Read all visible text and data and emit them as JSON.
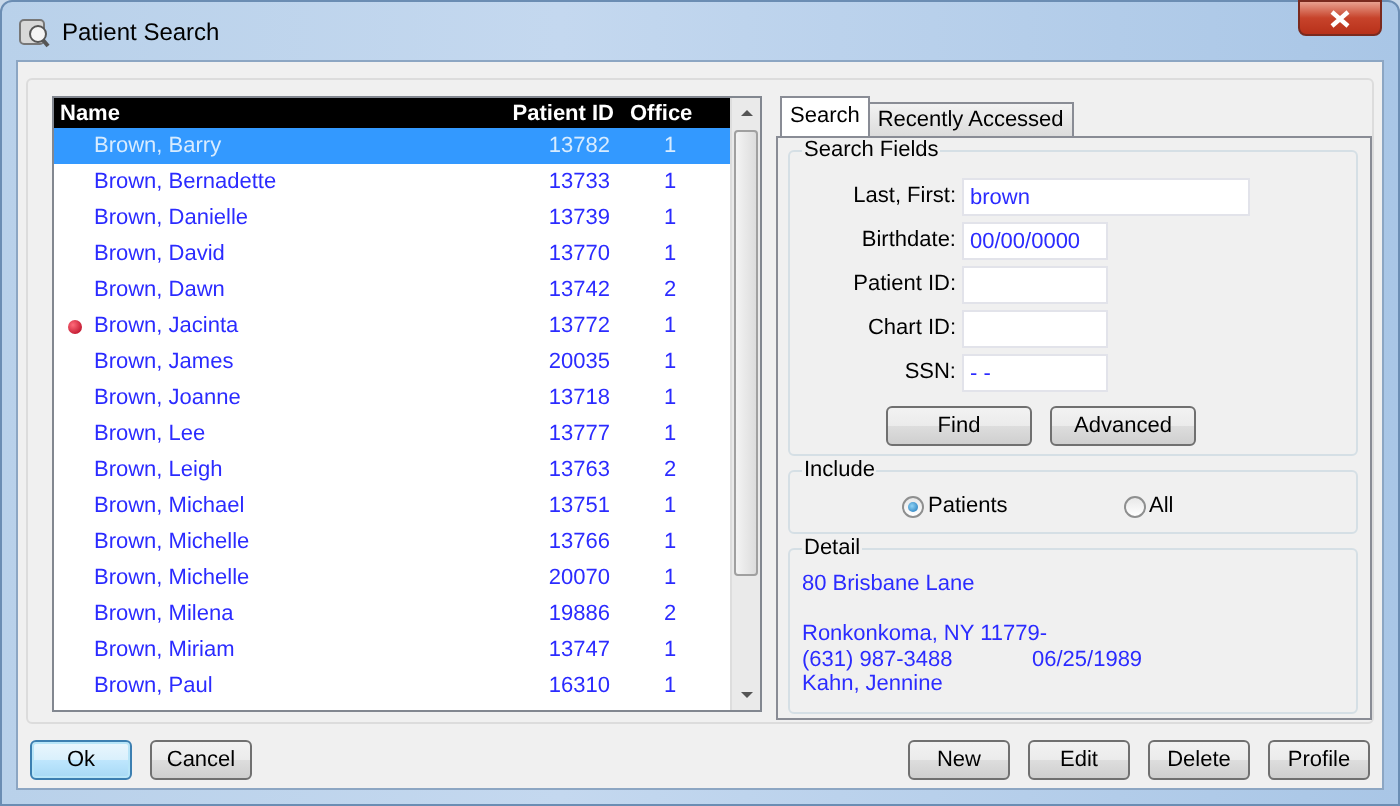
{
  "window": {
    "title": "Patient Search"
  },
  "patient_list": {
    "columns": [
      "Name",
      "Patient ID",
      "Office"
    ],
    "rows": [
      {
        "name": "Brown, Barry",
        "patient_id": "13782",
        "office": "1",
        "selected": true,
        "flagged": false
      },
      {
        "name": "Brown, Bernadette",
        "patient_id": "13733",
        "office": "1",
        "selected": false,
        "flagged": false
      },
      {
        "name": "Brown, Danielle",
        "patient_id": "13739",
        "office": "1",
        "selected": false,
        "flagged": false
      },
      {
        "name": "Brown, David",
        "patient_id": "13770",
        "office": "1",
        "selected": false,
        "flagged": false
      },
      {
        "name": "Brown, Dawn",
        "patient_id": "13742",
        "office": "2",
        "selected": false,
        "flagged": false
      },
      {
        "name": "Brown, Jacinta",
        "patient_id": "13772",
        "office": "1",
        "selected": false,
        "flagged": true
      },
      {
        "name": "Brown, James",
        "patient_id": "20035",
        "office": "1",
        "selected": false,
        "flagged": false
      },
      {
        "name": "Brown, Joanne",
        "patient_id": "13718",
        "office": "1",
        "selected": false,
        "flagged": false
      },
      {
        "name": "Brown, Lee",
        "patient_id": "13777",
        "office": "1",
        "selected": false,
        "flagged": false
      },
      {
        "name": "Brown, Leigh",
        "patient_id": "13763",
        "office": "2",
        "selected": false,
        "flagged": false
      },
      {
        "name": "Brown, Michael",
        "patient_id": "13751",
        "office": "1",
        "selected": false,
        "flagged": false
      },
      {
        "name": "Brown, Michelle",
        "patient_id": "13766",
        "office": "1",
        "selected": false,
        "flagged": false
      },
      {
        "name": "Brown, Michelle",
        "patient_id": "20070",
        "office": "1",
        "selected": false,
        "flagged": false
      },
      {
        "name": "Brown, Milena",
        "patient_id": "19886",
        "office": "2",
        "selected": false,
        "flagged": false
      },
      {
        "name": "Brown, Miriam",
        "patient_id": "13747",
        "office": "1",
        "selected": false,
        "flagged": false
      },
      {
        "name": "Brown, Paul",
        "patient_id": "16310",
        "office": "1",
        "selected": false,
        "flagged": false
      }
    ]
  },
  "tabs": [
    {
      "label": "Search",
      "selected": true
    },
    {
      "label": "Recently Accessed",
      "selected": false
    }
  ],
  "search_fields": {
    "title": "Search Fields",
    "fields": [
      {
        "label": "Last, First:",
        "value": "brown",
        "kind": "wide"
      },
      {
        "label": "Birthdate:",
        "value": "00/00/0000",
        "kind": "short"
      },
      {
        "label": "Patient ID:",
        "kind": "short"
      },
      {
        "label": "Chart ID:",
        "kind": "short"
      },
      {
        "label": "SSN:",
        "value": "- -",
        "kind": "short"
      }
    ],
    "buttons": [
      "Find",
      "Advanced"
    ]
  },
  "include": {
    "title": "Include",
    "options": [
      {
        "label": "Patients",
        "selected": true
      },
      {
        "label": "All",
        "selected": false
      }
    ]
  },
  "detail": {
    "title": "Detail",
    "address": "80 Brisbane Lane",
    "city_line": "Ronkonkoma, NY  11779-",
    "phone": "(631) 987-3488",
    "birthdate": "06/25/1989",
    "provider": "Kahn, Jennine"
  },
  "buttons_left": [
    {
      "label": "Ok",
      "default": true
    },
    {
      "label": "Cancel",
      "default": false
    }
  ],
  "buttons_right": [
    {
      "label": "New",
      "default": false
    },
    {
      "label": "Edit",
      "default": false
    },
    {
      "label": "Delete",
      "default": false
    },
    {
      "label": "Profile",
      "default": false
    }
  ]
}
